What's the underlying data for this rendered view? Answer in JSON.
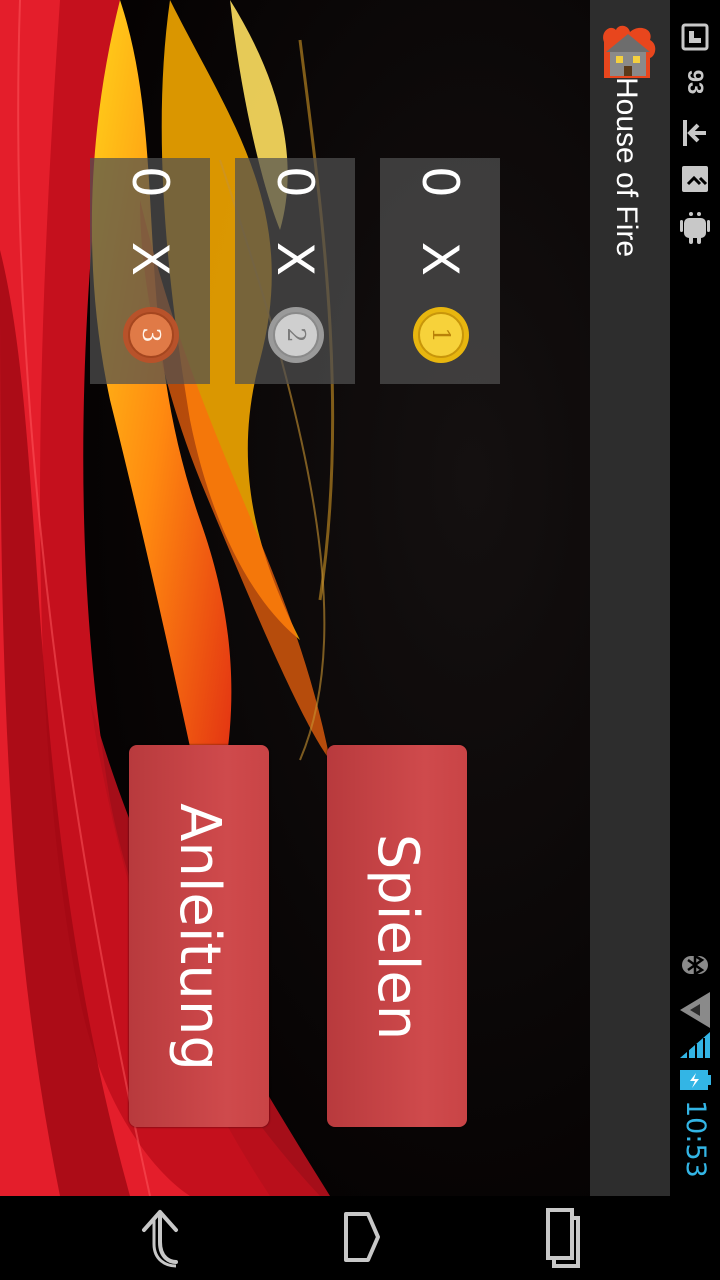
{
  "status_bar": {
    "time": "10:53",
    "battery_level": "93",
    "icons": [
      "bluetooth-icon",
      "signal-icon",
      "wifi-icon",
      "battery-icon",
      "sim-icon",
      "upload-icon",
      "usb-icon",
      "android-icon"
    ],
    "time_color": "#33b5e5"
  },
  "action_bar": {
    "title": "House of Fire",
    "icon": "house-fire-icon"
  },
  "scores": [
    {
      "label": "0 X",
      "coin": "gold-coin-1",
      "coin_number": "1",
      "coin_color": "#f2c41c"
    },
    {
      "label": "0 X",
      "coin": "silver-coin-2",
      "coin_number": "2",
      "coin_color": "#b9b9b9"
    },
    {
      "label": "0 X",
      "coin": "bronze-coin-3",
      "coin_number": "3",
      "coin_color": "#d66a3a"
    }
  ],
  "buttons": {
    "play": "Spielen",
    "instructions": "Anleitung",
    "color": "#c94446"
  },
  "nav_bar": {
    "icons": [
      "back-icon",
      "home-icon",
      "recents-icon"
    ]
  }
}
